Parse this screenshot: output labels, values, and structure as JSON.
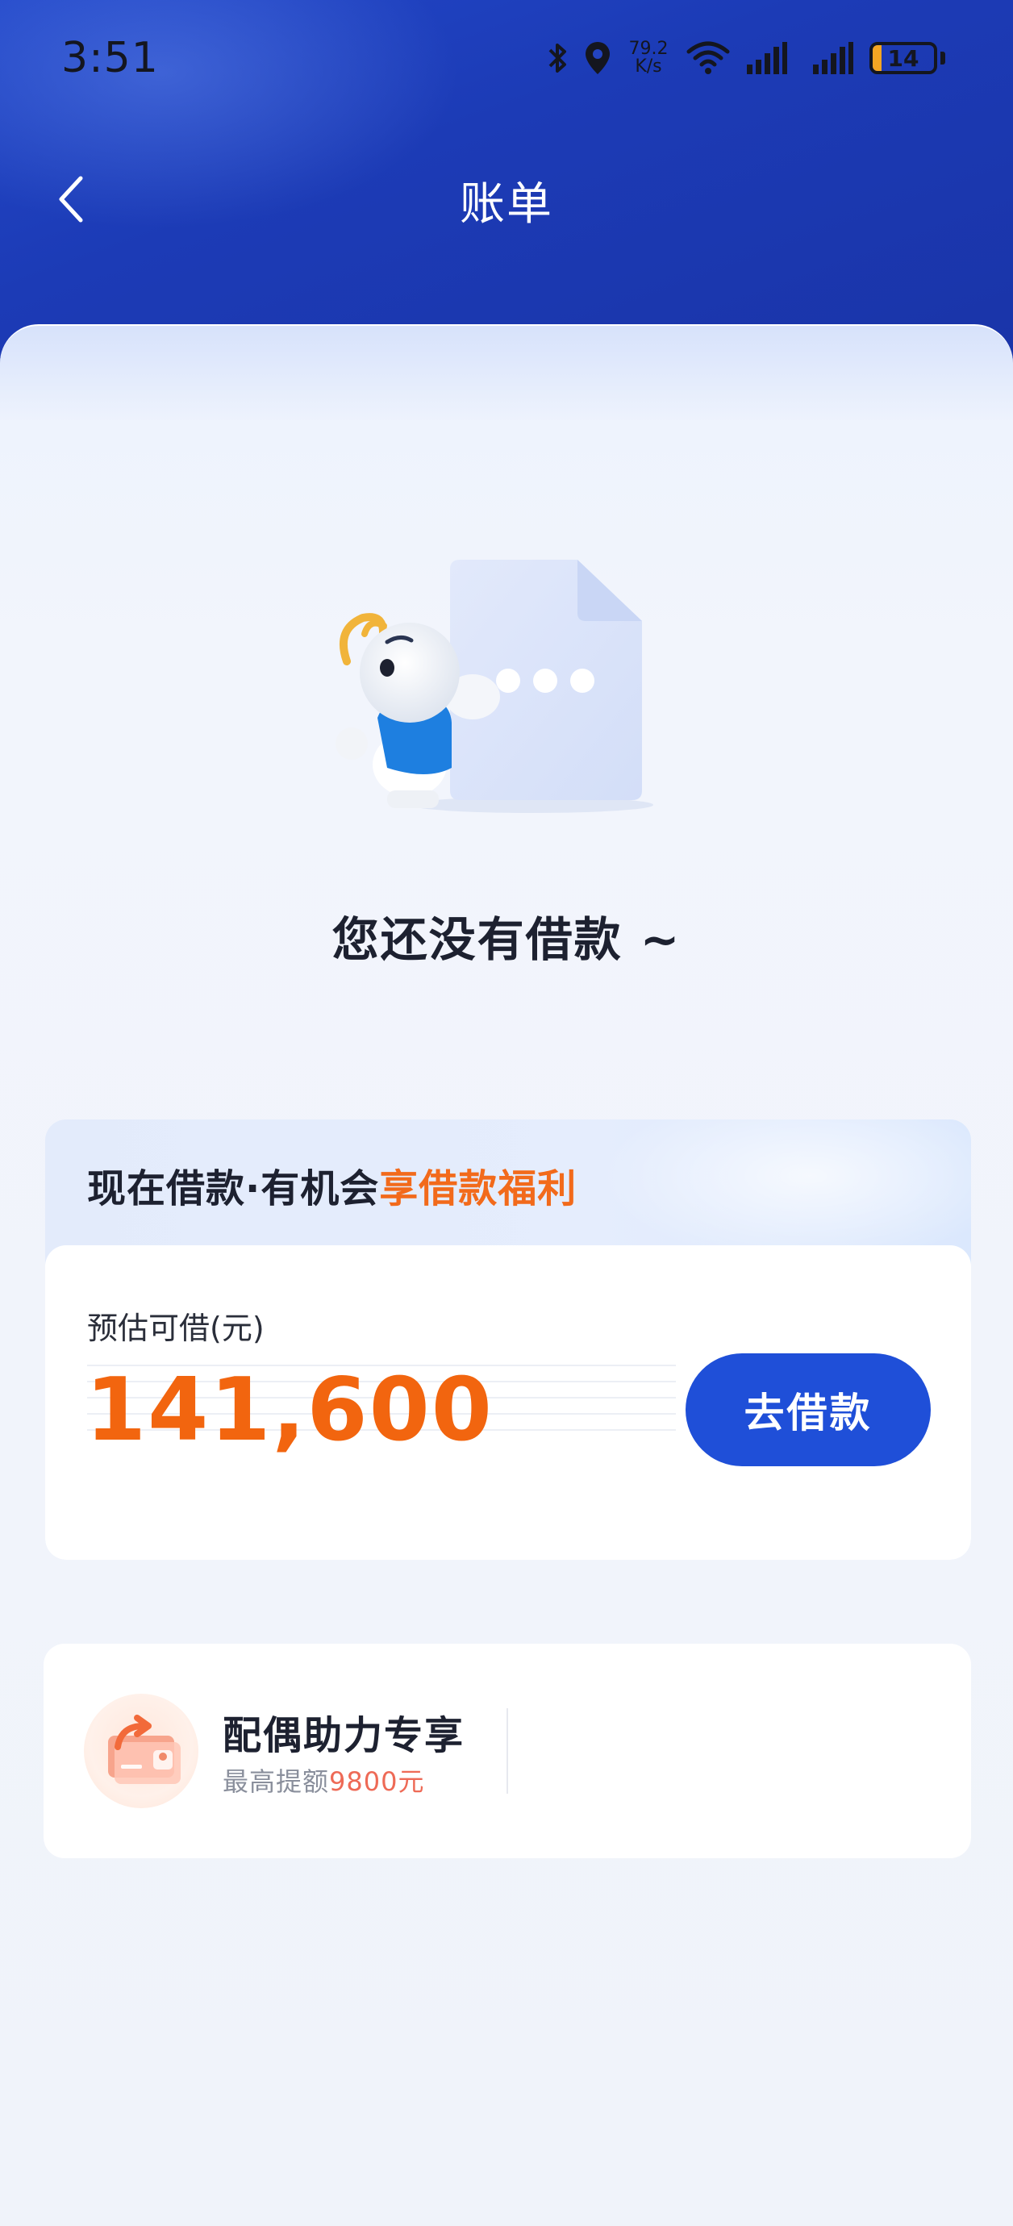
{
  "status_bar": {
    "time": "3:51",
    "net_speed_value": "79.2",
    "net_speed_unit": "K/s",
    "battery_level": "14",
    "icons": [
      "bluetooth-icon",
      "location-icon",
      "wifi-icon",
      "signal-icon",
      "signal-icon",
      "battery-icon"
    ]
  },
  "navbar": {
    "title": "账单",
    "back_icon": "chevron-left-icon"
  },
  "empty_state": {
    "message": "您还没有借款 ~"
  },
  "loan_card": {
    "banner_prefix": "现在借款·有机会",
    "banner_highlight": "享借款福利",
    "estimate_label": "预估可借(元)",
    "amount": "141,600",
    "button_label": "去借款"
  },
  "spouse_card": {
    "title": "配偶助力专享",
    "subtitle_prefix": "最高提额",
    "subtitle_highlight": "9800元"
  },
  "colors": {
    "header_blue": "#1c3bb6",
    "accent_orange": "#f2650f",
    "button_blue": "#1f4fd8"
  }
}
